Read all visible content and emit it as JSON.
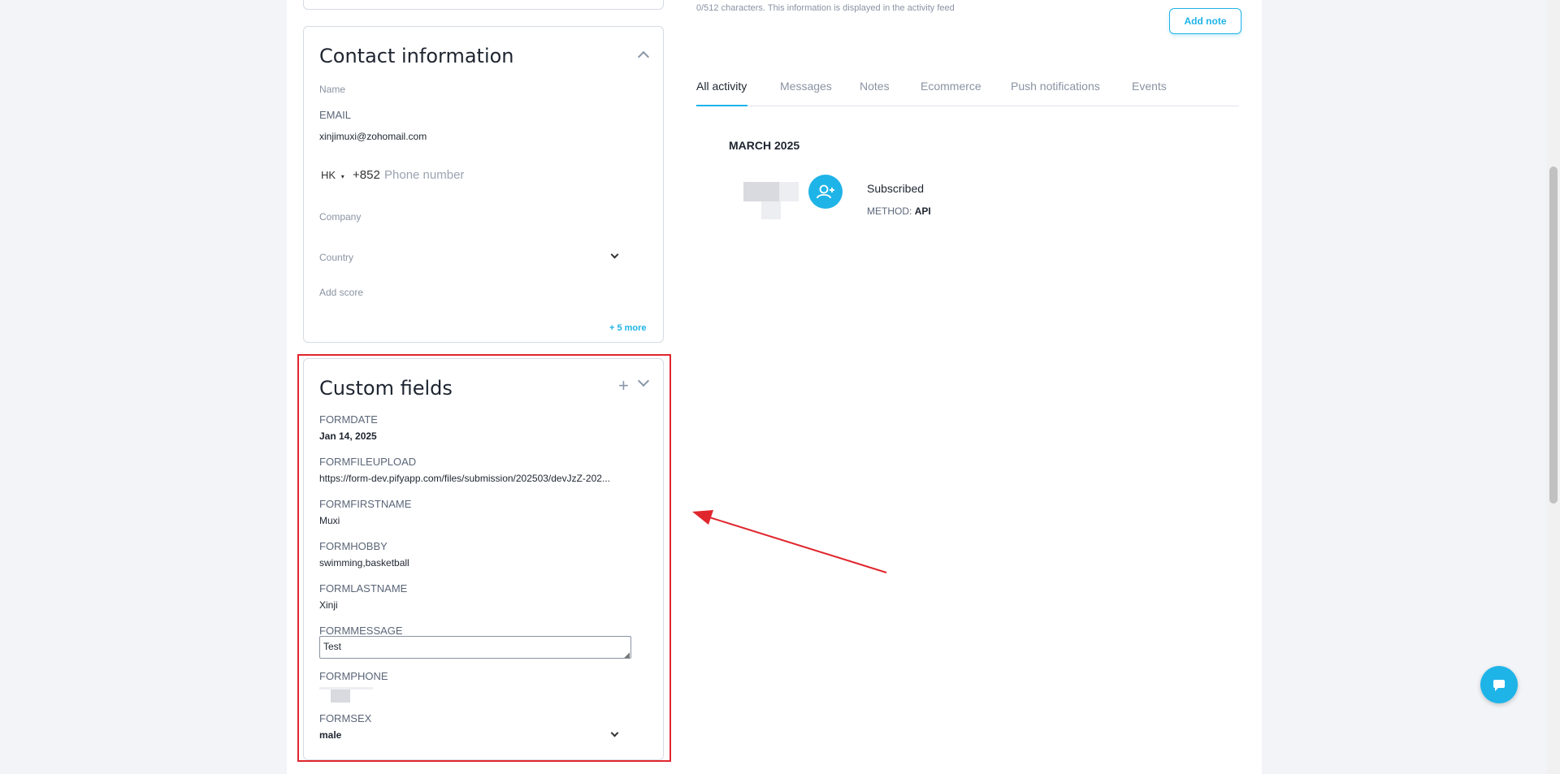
{
  "top_card": {},
  "note": {
    "char_hint": "0/512 characters. This information is displayed in the activity feed",
    "add_note_label": "Add note"
  },
  "contact": {
    "title": "Contact information",
    "name_label": "Name",
    "email_label": "EMAIL",
    "email_value": "xinjimuxi@zohomail.com",
    "phone_country": "HK",
    "phone_code": "+852",
    "phone_placeholder": "Phone number",
    "company_label": "Company",
    "country_label": "Country",
    "score_label": "Add score",
    "more_link": "+ 5 more"
  },
  "custom": {
    "title": "Custom fields",
    "add_symbol": "+",
    "fields": [
      {
        "label": "FORMDATE",
        "value": "Jan 14, 2025"
      },
      {
        "label": "FORMFILEUPLOAD",
        "value": "https://form-dev.pifyapp.com/files/submission/202503/devJzZ-202..."
      },
      {
        "label": "FORMFIRSTNAME",
        "value": "Muxi"
      },
      {
        "label": "FORMHOBBY",
        "value": "swimming,basketball"
      },
      {
        "label": "FORMLASTNAME",
        "value": "Xinji"
      },
      {
        "label": "FORMMESSAGE",
        "value": "Test"
      },
      {
        "label": "FORMPHONE",
        "value": ""
      },
      {
        "label": "FORMSEX",
        "value": "male"
      }
    ]
  },
  "tabs": [
    "All activity",
    "Messages",
    "Notes",
    "Ecommerce",
    "Push notifications",
    "Events"
  ],
  "activity": {
    "month": "MARCH 2025",
    "event_title": "Subscribed",
    "method_label": "METHOD:",
    "method_value": "API"
  },
  "colors": {
    "accent": "#1fb4e8",
    "annotation_red": "#e0262d"
  },
  "icons": {
    "event_icon": "user-plus-icon",
    "chat_icon": "chat-bubble-icon"
  }
}
